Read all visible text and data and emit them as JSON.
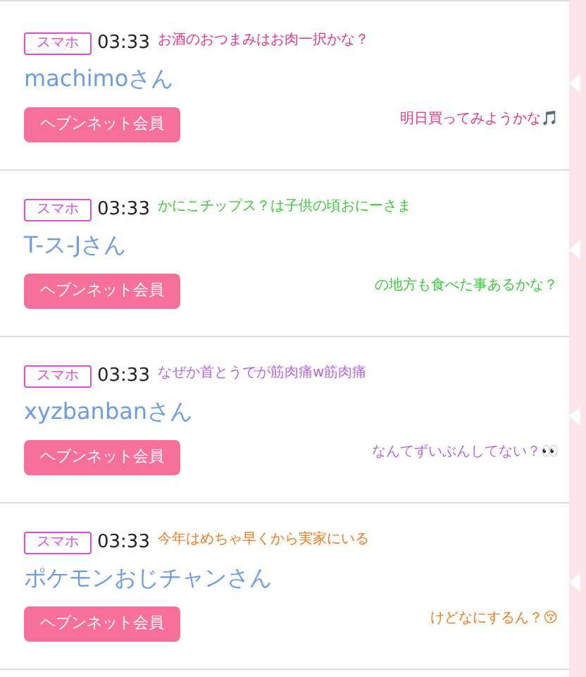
{
  "comments": [
    {
      "device": "スマホ",
      "time": "03:33",
      "user": "machimoさん",
      "member_badge": "ヘブンネット会員",
      "overlay": {
        "color": "#e8338a",
        "lines": [
          "お酒のおつまみはお肉一択かな？",
          "明日買ってみようかな🎵"
        ]
      }
    },
    {
      "device": "スマホ",
      "time": "03:33",
      "user": "T-ス-Jさん",
      "member_badge": "ヘブンネット会員",
      "overlay": {
        "color": "#3cc83c",
        "lines": [
          "かにこチップス？は子供の頃おにーさま",
          "の地方も食べた事あるかな？"
        ]
      }
    },
    {
      "device": "スマホ",
      "time": "03:33",
      "user": "xyzbanbanさん",
      "member_badge": "ヘブンネット会員",
      "overlay": {
        "color": "#b565e0",
        "lines": [
          "なぜか首とうでが筋肉痛w筋肉痛",
          "なんてずいぶんしてない？👀"
        ]
      }
    },
    {
      "device": "スマホ",
      "time": "03:33",
      "user": "ポケモンおじチャンさん",
      "member_badge": "ヘブンネット会員",
      "overlay": {
        "color": "#f07a20",
        "lines": [
          "今年はめちゃ早くから実家にいる",
          "けどなにするん？😚"
        ]
      }
    }
  ]
}
